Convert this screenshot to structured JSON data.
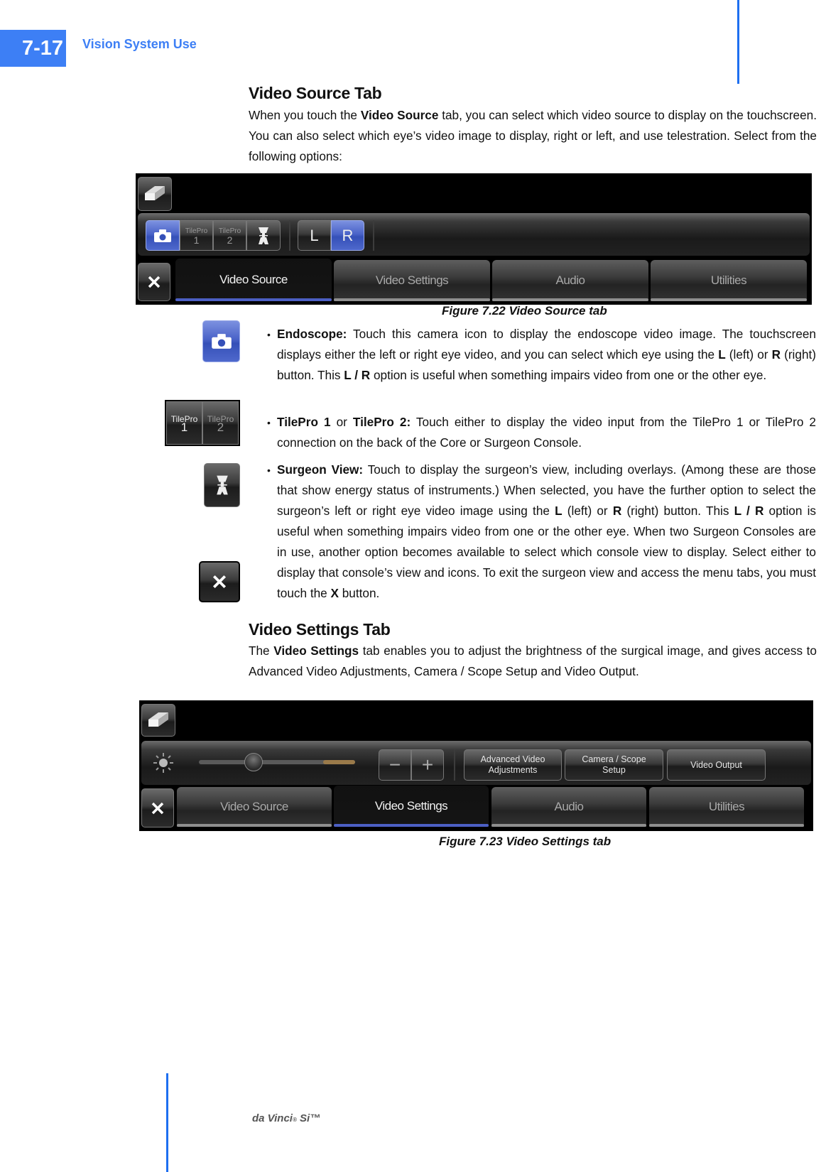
{
  "header": {
    "page_number": "7-17",
    "chapter_title": "Vision System Use"
  },
  "section1": {
    "heading": "Video Source Tab",
    "intro_parts": [
      "When you touch the ",
      "Video Source",
      " tab, you can select which video source to display on the touchscreen. You can also select which eye’s video image to display, right or left, and use telestration. Select from the following options:"
    ]
  },
  "figure1": {
    "caption": "Figure 7.22 Video Source tab",
    "source_buttons": [
      {
        "name": "endoscope",
        "icon": "camera-icon",
        "selected": true
      },
      {
        "name": "tilepro-1",
        "label": "TilePro",
        "number": "1",
        "selected": false
      },
      {
        "name": "tilepro-2",
        "label": "TilePro",
        "number": "2",
        "selected": false
      },
      {
        "name": "surgeon-view",
        "icon": "surgeon-view-icon",
        "selected": false
      }
    ],
    "eye_buttons": [
      {
        "label": "L",
        "selected": false
      },
      {
        "label": "R",
        "selected": true
      }
    ],
    "tabs": [
      {
        "label": "Video Source",
        "active": true
      },
      {
        "label": "Video Settings",
        "active": false
      },
      {
        "label": "Audio",
        "active": false
      },
      {
        "label": "Utilities",
        "active": false
      }
    ],
    "eraser_icon": "eraser-icon",
    "close_icon": "close-icon"
  },
  "bullets": [
    {
      "icon": "camera-icon",
      "term": "Endoscope:",
      "text_parts": [
        " Touch this camera icon to display the endoscope video image. The touchscreen displays either the left or right eye video, and you can select which eye using the ",
        "L",
        " (left) or ",
        "R",
        " (right) button. This ",
        "L / R",
        " option is useful when something impairs video from one or the other eye."
      ]
    },
    {
      "icon": "tilepro-icon",
      "term": "TilePro 1",
      "text_parts": [
        " or ",
        "TilePro 2:",
        " Touch either to display the video input from the TilePro 1 or TilePro 2 connection on the back of the Core or Surgeon Console."
      ],
      "icon_labels": [
        "TilePro",
        "1",
        "TilePro",
        "2"
      ]
    },
    {
      "icon": "surgeon-view-icon",
      "term": "Surgeon View:",
      "text_parts": [
        " Touch to display the surgeon’s view, including overlays. (Among these are those that show energy status of instruments.) When selected, you have the further option to select the surgeon’s left or right eye video image using the ",
        "L",
        " (left) or ",
        "R",
        " (right) button. This ",
        "L / R",
        " option is useful when something impairs video from one or the other eye. When two Surgeon Consoles are in use, another option becomes available to select which console view to display. Select either to display that console’s view and icons. To exit the surgeon view and access the menu tabs, you must touch the ",
        "X",
        " button."
      ]
    }
  ],
  "section2": {
    "heading": "Video Settings Tab",
    "intro_parts": [
      "The ",
      "Video Settings",
      " tab enables you to adjust the brightness of the surgical image, and gives access to Advanced Video Adjustments, Camera / Scope Setup and Video Output."
    ]
  },
  "figure2": {
    "caption": "Figure 7.23 Video Settings tab",
    "brightness_icon": "brightness-icon",
    "brightness_level": 0.35,
    "minus_label": "−",
    "plus_label": "+",
    "buttons": [
      {
        "label_line1": "Advanced Video",
        "label_line2": "Adjustments"
      },
      {
        "label_line1": "Camera / Scope",
        "label_line2": "Setup"
      },
      {
        "label_line1": "Video Output",
        "label_line2": ""
      }
    ],
    "tabs": [
      {
        "label": "Video Source",
        "active": false
      },
      {
        "label": "Video Settings",
        "active": true
      },
      {
        "label": "Audio",
        "active": false
      },
      {
        "label": "Utilities",
        "active": false
      }
    ]
  },
  "footer": {
    "brand": "da Vinci",
    "registered": "®",
    "model": " Si™"
  },
  "colors": {
    "accent_blue": "#3d7ff5",
    "selected_button_blue": "#4a63c8"
  }
}
